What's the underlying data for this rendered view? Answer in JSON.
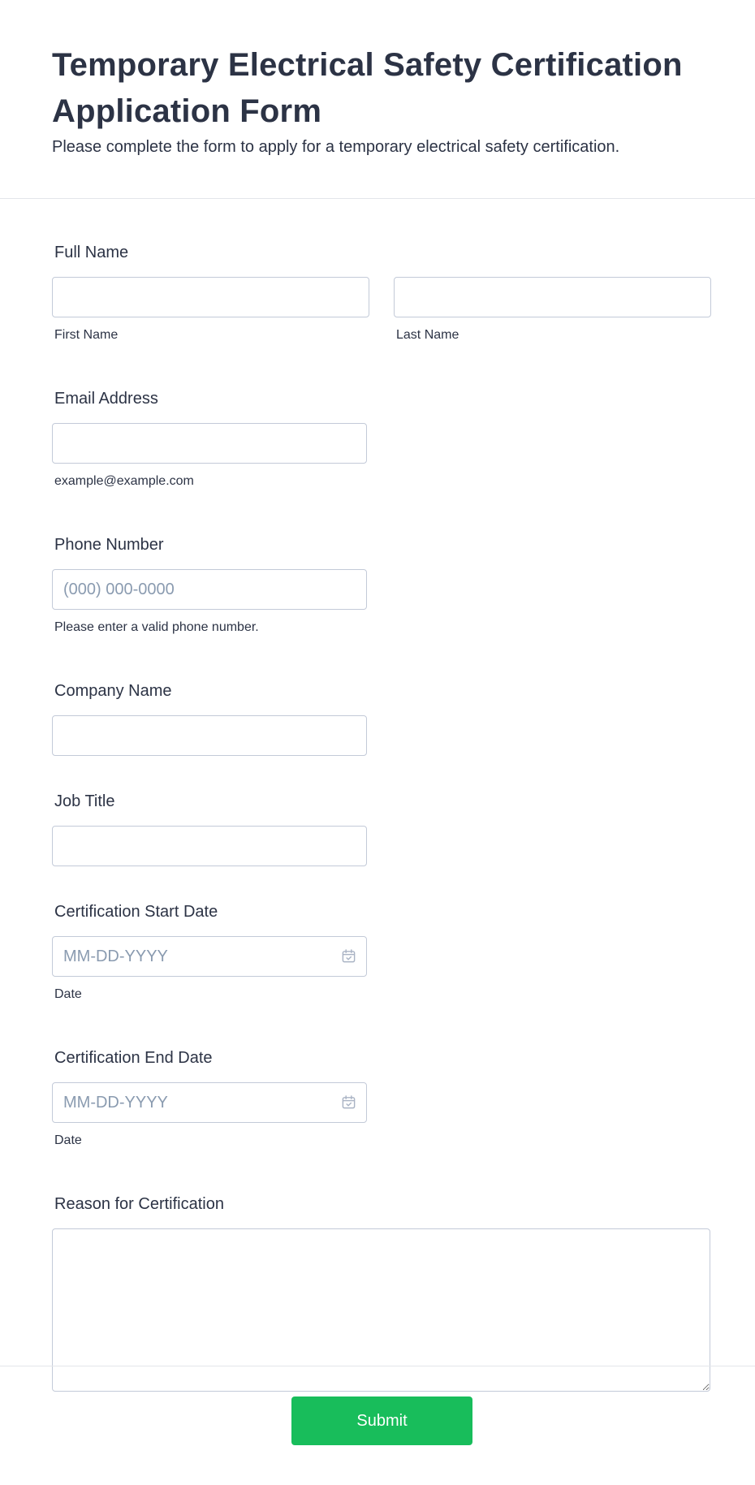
{
  "header": {
    "title": "Temporary Electrical Safety Certification Application Form",
    "subtitle": "Please complete the form to apply for a temporary electrical safety certification."
  },
  "fields": {
    "full_name": {
      "label": "Full Name",
      "first_sublabel": "First Name",
      "last_sublabel": "Last Name",
      "first_value": "",
      "last_value": ""
    },
    "email": {
      "label": "Email Address",
      "sublabel": "example@example.com",
      "value": ""
    },
    "phone": {
      "label": "Phone Number",
      "placeholder": "(000) 000-0000",
      "sublabel": "Please enter a valid phone number.",
      "value": ""
    },
    "company": {
      "label": "Company Name",
      "value": ""
    },
    "job_title": {
      "label": "Job Title",
      "value": ""
    },
    "start_date": {
      "label": "Certification Start Date",
      "placeholder": "MM-DD-YYYY",
      "sublabel": "Date",
      "icon": "calendar-icon"
    },
    "end_date": {
      "label": "Certification End Date",
      "placeholder": "MM-DD-YYYY",
      "sublabel": "Date",
      "icon": "calendar-icon"
    },
    "reason": {
      "label": "Reason for Certification",
      "value": ""
    }
  },
  "footer": {
    "submit_label": "Submit"
  },
  "colors": {
    "text": "#2c3345",
    "border": "#c3cad8",
    "placeholder": "#8a9bb0",
    "submit": "#18bd5b"
  }
}
